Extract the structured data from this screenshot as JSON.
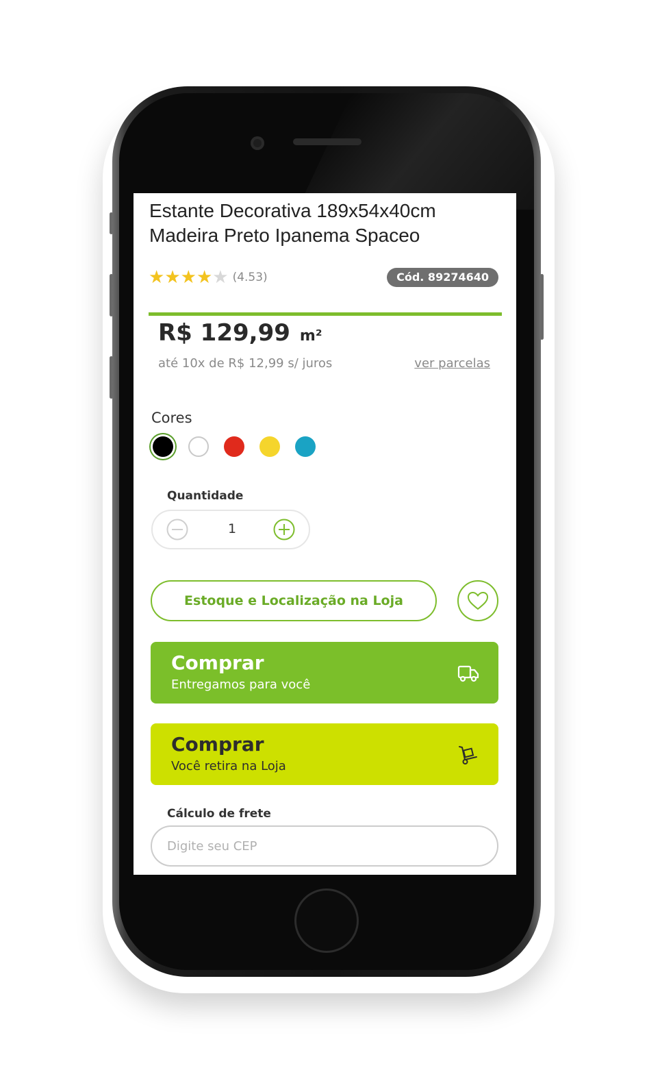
{
  "product": {
    "title_line1": "Estante Decorativa 189x54x40cm",
    "title_line2": "Madeira Preto Ipanema Spaceo",
    "rating_stars_filled": 4,
    "rating_stars_total": 5,
    "rating_value": "(4.53)",
    "code": "Cód. 89274640"
  },
  "price": {
    "amount": "R$ 129,99",
    "unit": "m²",
    "installments": "até 10x de R$ 12,99 s/ juros",
    "installments_link": "ver parcelas"
  },
  "colors": {
    "label": "Cores",
    "options": [
      {
        "name": "black",
        "hex": "#000000",
        "selected": true
      },
      {
        "name": "white",
        "hex": "#ffffff",
        "selected": false
      },
      {
        "name": "red",
        "hex": "#e02a1c",
        "selected": false
      },
      {
        "name": "yellow",
        "hex": "#f5d52c",
        "selected": false
      },
      {
        "name": "blue",
        "hex": "#1aa3c4",
        "selected": false
      }
    ]
  },
  "quantity": {
    "label": "Quantidade",
    "value": "1",
    "minus_icon": "minus-circle-icon",
    "plus_icon": "plus-circle-icon"
  },
  "actions": {
    "stock_label": "Estoque e Localização na Loja",
    "favorite_icon": "heart-icon",
    "buy_delivery_title": "Comprar",
    "buy_delivery_sub": "Entregamos para você",
    "buy_delivery_icon": "truck-icon",
    "buy_pickup_title": "Comprar",
    "buy_pickup_sub": "Você retira na Loja",
    "buy_pickup_icon": "hand-truck-icon"
  },
  "shipping": {
    "label": "Cálculo de frete",
    "placeholder": "Digite seu CEP"
  },
  "theme": {
    "green": "#7bbf2a",
    "lime": "#cde000",
    "star": "#f3c31f",
    "badge": "#6f6f6f"
  }
}
